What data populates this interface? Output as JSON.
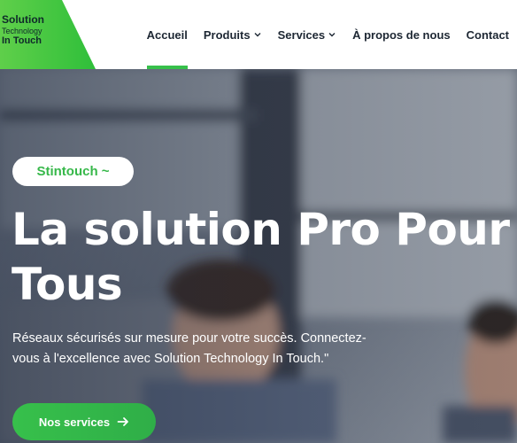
{
  "brand": {
    "line1": "Solution",
    "line2": "Technology",
    "line3": "In Touch",
    "colors": {
      "green": "#37c04b",
      "dark": "#1d2733"
    }
  },
  "nav": {
    "items": [
      {
        "label": "Accueil",
        "active": true,
        "icon": ""
      },
      {
        "label": "Produits",
        "active": false,
        "icon": "chevron-down-icon"
      },
      {
        "label": "Services",
        "active": false,
        "icon": "chevron-down-icon"
      },
      {
        "label": "À propos de nous",
        "active": false,
        "icon": ""
      },
      {
        "label": "Contact",
        "active": false,
        "icon": ""
      }
    ]
  },
  "hero": {
    "badge": "Stintouch ~",
    "title": "La solution Pro Pour Tous",
    "description": "Réseaux sécurisés sur mesure pour votre succès. Connectez-vous à l'excellence avec Solution Technology In Touch.\"",
    "cta_label": "Nos services",
    "cta_icon": "arrow-right-icon"
  }
}
